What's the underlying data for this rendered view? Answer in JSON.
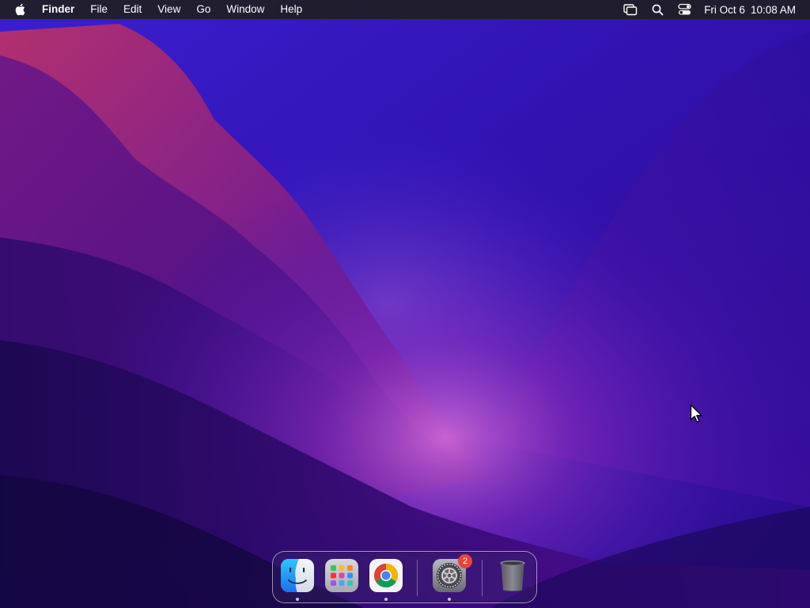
{
  "menubar": {
    "apple_icon": "apple-logo-icon",
    "app_name": "Finder",
    "menus": [
      "File",
      "Edit",
      "View",
      "Go",
      "Window",
      "Help"
    ],
    "status_icons": [
      "screen-mirroring-icon",
      "spotlight-search-icon",
      "control-center-icon"
    ],
    "clock": {
      "date": "Fri Oct 6",
      "time": "10:08 AM"
    }
  },
  "dock": {
    "apps": [
      {
        "name": "Finder",
        "icon": "finder-icon",
        "running": true
      },
      {
        "name": "Launchpad",
        "icon": "launchpad-icon",
        "running": false
      },
      {
        "name": "Google Chrome",
        "icon": "chrome-icon",
        "running": true
      },
      {
        "name": "System Settings",
        "icon": "system-settings-icon",
        "running": true,
        "badge": "2"
      },
      {
        "name": "Trash",
        "icon": "trash-icon",
        "running": false
      }
    ]
  },
  "wallpaper": {
    "name": "macOS Monterey",
    "colors": {
      "deep": "#1a0a5e",
      "violet": "#3a12b8",
      "magenta": "#9a1fa6",
      "glow": "#c85ad0",
      "pink": "#b2307a"
    }
  },
  "colors": {
    "menubar_bg": "#1e1e22",
    "badge": "#e8443a",
    "text": "#ffffff"
  }
}
